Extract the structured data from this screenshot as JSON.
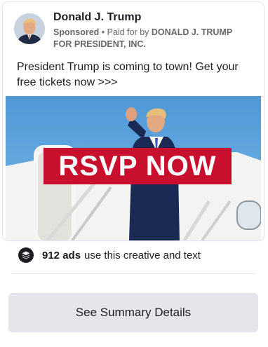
{
  "ad": {
    "page_name": "Donald J. Trump",
    "sponsored_label": "Sponsored",
    "separator": "•",
    "paid_for_prefix": "Paid for by",
    "paid_for_entity": "DONALD J. TRUMP FOR PRESIDENT, INC.",
    "body_text": "President Trump is coming to town! Get your free tickets now >>>",
    "creative_banner_text": "RSVP NOW"
  },
  "library": {
    "icon": "stack-layers-icon",
    "ads_count_text": "912 ads",
    "ads_description": "use this creative and text",
    "summary_button_label": "See Summary Details"
  },
  "colors": {
    "banner_red": "#c8102e",
    "sky_blue": "#5aa0d8",
    "button_gray": "#e4e6eb",
    "secondary_text": "#65676b"
  }
}
